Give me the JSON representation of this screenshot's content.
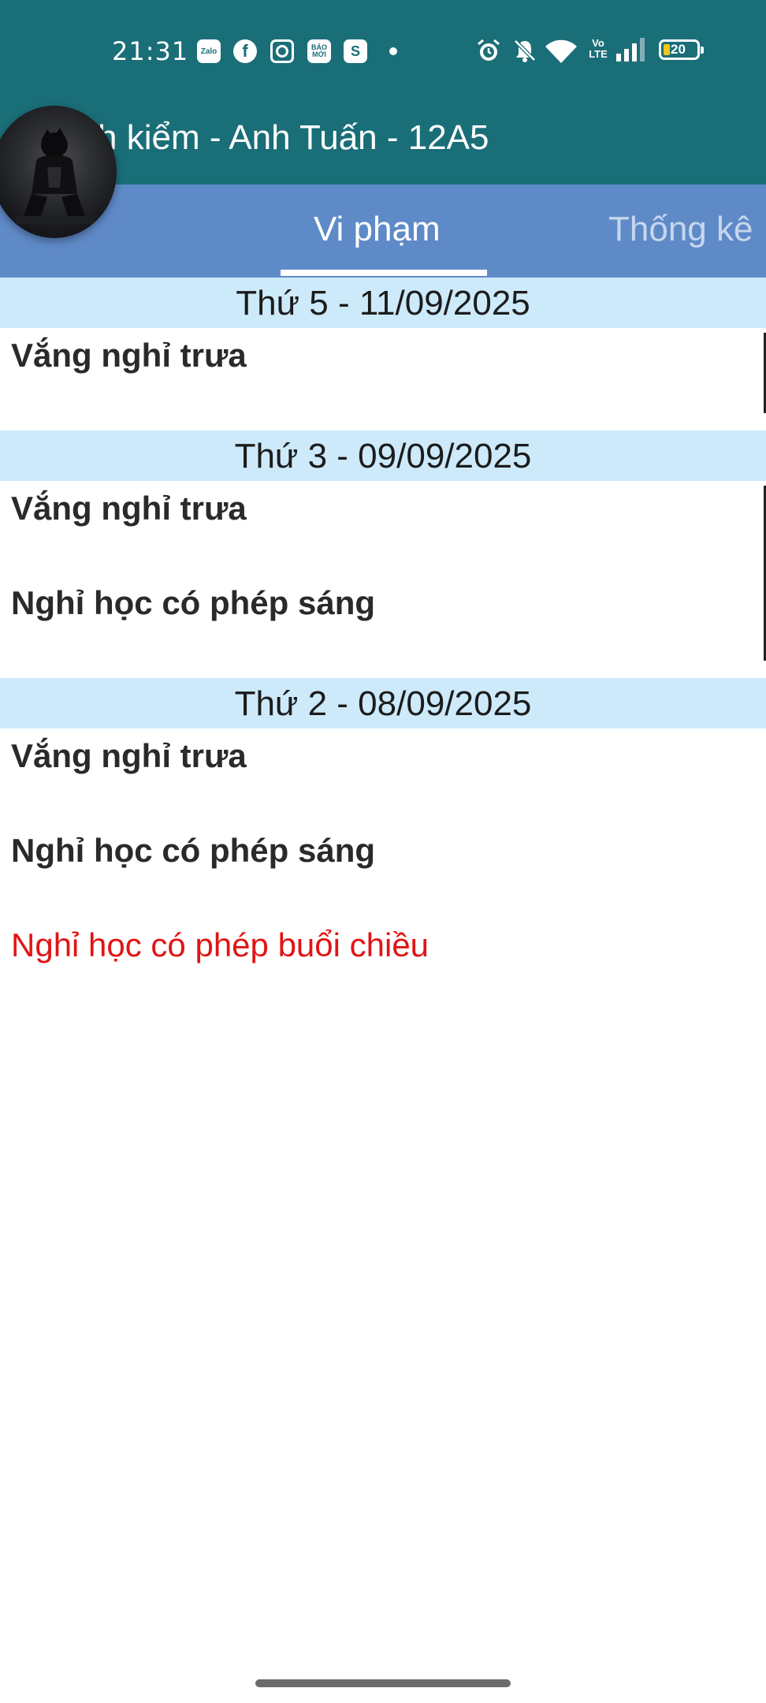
{
  "status_bar": {
    "time": "21:31",
    "notification_icons": [
      "zalo-icon",
      "facebook-icon",
      "instagram-icon",
      "baomoi-icon",
      "shopee-icon"
    ],
    "zalo_text": "Zalo",
    "baomoi_text": "BÁO MỚI",
    "volte_text": "Vo LTE",
    "battery_level": "20"
  },
  "app_bar": {
    "title": "Hạnh kiểm - Anh Tuấn - 12A5",
    "visible_title": "h kiểm - Anh Tuấn - 12A5"
  },
  "tabs": [
    {
      "label": "Vi phạm",
      "active": true
    },
    {
      "label": "Thống kê",
      "active": false
    }
  ],
  "colors": {
    "status_bar": "#1a6e78",
    "tab_bar": "#5f8ac8",
    "date_header": "#cdeafb",
    "highlight_red": "#e11414"
  },
  "groups": [
    {
      "date": "Thứ 5 - 11/09/2025",
      "items": [
        {
          "label": "Vắng nghỉ trưa",
          "highlight": false
        }
      ]
    },
    {
      "date": "Thứ 3 - 09/09/2025",
      "items": [
        {
          "label": "Vắng nghỉ trưa",
          "highlight": false
        },
        {
          "label": "Nghỉ học có phép sáng",
          "highlight": false
        }
      ]
    },
    {
      "date": "Thứ 2 - 08/09/2025",
      "items": [
        {
          "label": "Vắng nghỉ trưa",
          "highlight": false
        },
        {
          "label": "Nghỉ học có phép sáng",
          "highlight": false
        },
        {
          "label": "Nghỉ học có phép buổi chiều",
          "highlight": true
        }
      ]
    }
  ]
}
